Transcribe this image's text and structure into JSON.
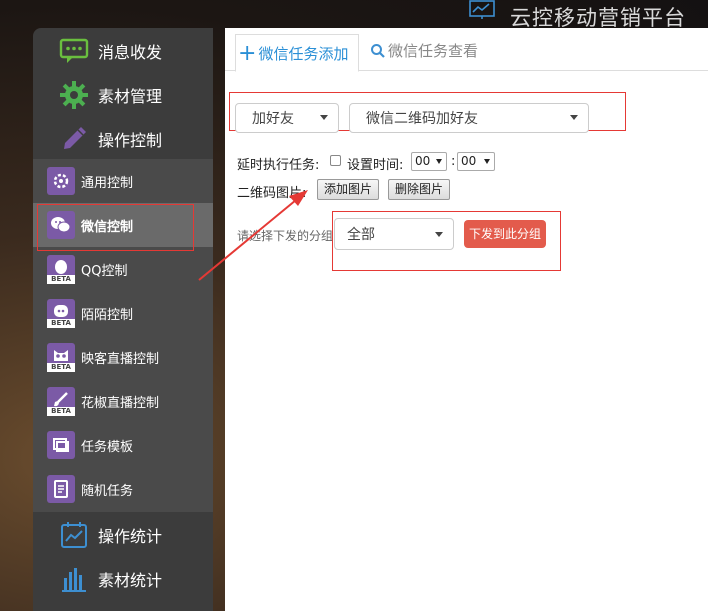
{
  "app": {
    "title": "云控移动营销平台"
  },
  "sidebar": {
    "top_items": [
      {
        "label": "消息收发",
        "icon": "chat-icon"
      },
      {
        "label": "素材管理",
        "icon": "gear-icon"
      },
      {
        "label": "操作控制",
        "icon": "pen-icon"
      }
    ],
    "sub_items": [
      {
        "label": "通用控制",
        "icon": "settings-icon",
        "beta": false
      },
      {
        "label": "微信控制",
        "icon": "wechat-icon",
        "beta": false,
        "active": true
      },
      {
        "label": "QQ控制",
        "icon": "qq-icon",
        "beta": true
      },
      {
        "label": "陌陌控制",
        "icon": "momo-icon",
        "beta": true
      },
      {
        "label": "映客直播控制",
        "icon": "owl-icon",
        "beta": true
      },
      {
        "label": "花椒直播控制",
        "icon": "brush-icon",
        "beta": true
      },
      {
        "label": "任务模板",
        "icon": "template-icon",
        "beta": false
      },
      {
        "label": "随机任务",
        "icon": "document-icon",
        "beta": false
      }
    ],
    "bottom_items": [
      {
        "label": "操作统计",
        "icon": "chart-line-icon"
      },
      {
        "label": "素材统计",
        "icon": "bar-chart-icon"
      }
    ],
    "beta_text": "BETA"
  },
  "tabs": {
    "add_label": "微信任务添加",
    "view_label": "微信任务查看"
  },
  "form": {
    "action_select": "加好友",
    "mode_select": "微信二维码加好友",
    "delay_label": "延时执行任务:",
    "set_time_label": "设置时间:",
    "hour_value": "00",
    "minute_value": "00",
    "time_separator": ":",
    "qr_label": "二维码图片:",
    "add_image_button": "添加图片",
    "delete_image_button": "删除图片",
    "group_hint": "请选择下发的分组",
    "group_select": "全部",
    "dispatch_button": "下发到此分组"
  },
  "colors": {
    "accent_blue": "#2a8fd6",
    "sidebar_icon_purple": "#7b5aa6",
    "highlight_red": "#e53935",
    "dispatch_red": "#e35b4c"
  }
}
